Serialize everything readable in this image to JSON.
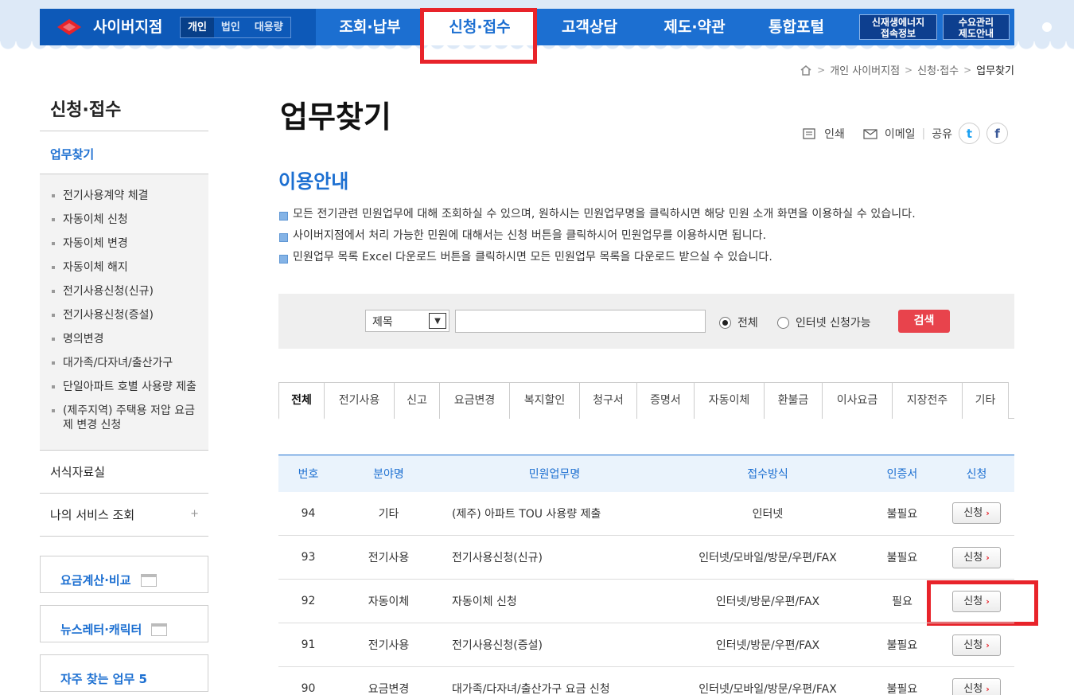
{
  "header": {
    "brand": "사이버지점",
    "segments": [
      {
        "label": "개인",
        "active": true
      },
      {
        "label": "법인",
        "active": false
      },
      {
        "label": "대용량",
        "active": false
      }
    ],
    "menus": [
      {
        "label": "조회·납부",
        "active": false
      },
      {
        "label": "신청·접수",
        "active": true
      },
      {
        "label": "고객상담",
        "active": false
      },
      {
        "label": "제도·약관",
        "active": false
      },
      {
        "label": "통합포털",
        "active": false
      }
    ],
    "sub_buttons": [
      {
        "line1": "신재생에너지",
        "line2": "접속정보"
      },
      {
        "line1": "수요관리",
        "line2": "제도안내"
      }
    ]
  },
  "breadcrumb": {
    "items": [
      "개인 사이버지점",
      "신청·접수"
    ],
    "current": "업무찾기"
  },
  "lnb": {
    "title": "신청·접수",
    "current": "업무찾기",
    "sub_items": [
      "전기사용계약 체결",
      "자동이체 신청",
      "자동이체 변경",
      "자동이체 해지",
      "전기사용신청(신규)",
      "전기사용신청(증설)",
      "명의변경",
      "대가족/다자녀/출산가구",
      "단일아파트 호별 사용량 제출",
      "(제주지역) 주택용 저압 요금제 변경 신청"
    ],
    "items": [
      "서식자료실",
      "나의 서비스 조회"
    ],
    "plus": "+",
    "quick": [
      "요금계산·비교",
      "뉴스레터·캐릭터",
      "자주 찾는 업무 5"
    ]
  },
  "page": {
    "title": "업무찾기",
    "share": {
      "print": "인쇄",
      "email": "이메일",
      "share": "공유",
      "twitter": "t",
      "facebook": "f"
    },
    "section_title": "이용안내",
    "guide": [
      "모든 전기관련 민원업무에 대해 조회하실 수 있으며, 원하시는 민원업무명을 클릭하시면 해당 민원 소개 화면을 이용하실 수 있습니다.",
      "사이버지점에서 처리 가능한 민원에 대해서는 신청 버튼을 클릭하시어 민원업무를 이용하시면 됩니다.",
      "민원업무 목록 Excel 다운로드 버튼을 클릭하시면 모든 민원업무 목록을 다운로드 받으실 수 있습니다."
    ]
  },
  "search": {
    "select_value": "제목",
    "keyword": "",
    "radio_all": "전체",
    "radio_online": "인터넷 신청가능",
    "button": "검색"
  },
  "tabs": [
    "전체",
    "전기사용",
    "신고",
    "요금변경",
    "복지할인",
    "청구서",
    "증명서",
    "자동이체",
    "환불금",
    "이사요금",
    "지장전주",
    "기타"
  ],
  "table": {
    "headers": [
      "번호",
      "분야명",
      "민원업무명",
      "접수방식",
      "인증서",
      "신청"
    ],
    "rows": [
      {
        "no": "94",
        "field": "기타",
        "name": "(제주) 아파트 TOU 사용량 제출",
        "method": "인터넷",
        "cert": "불필요",
        "apply": "신청"
      },
      {
        "no": "93",
        "field": "전기사용",
        "name": "전기사용신청(신규)",
        "method": "인터넷/모바일/방문/우편/FAX",
        "cert": "불필요",
        "apply": "신청"
      },
      {
        "no": "92",
        "field": "자동이체",
        "name": "자동이체 신청",
        "method": "인터넷/방문/우편/FAX",
        "cert": "필요",
        "apply": "신청"
      },
      {
        "no": "91",
        "field": "전기사용",
        "name": "전기사용신청(증설)",
        "method": "인터넷/방문/우편/FAX",
        "cert": "불필요",
        "apply": "신청"
      },
      {
        "no": "90",
        "field": "요금변경",
        "name": "대가족/다자녀/출산가구 요금 신청",
        "method": "인터넷/모바일/방문/우편/FAX",
        "cert": "불필요",
        "apply": "신청"
      }
    ]
  },
  "colors": {
    "primary": "#1c6fd1",
    "highlight": "#e8232a",
    "search_button": "#e8434c"
  }
}
